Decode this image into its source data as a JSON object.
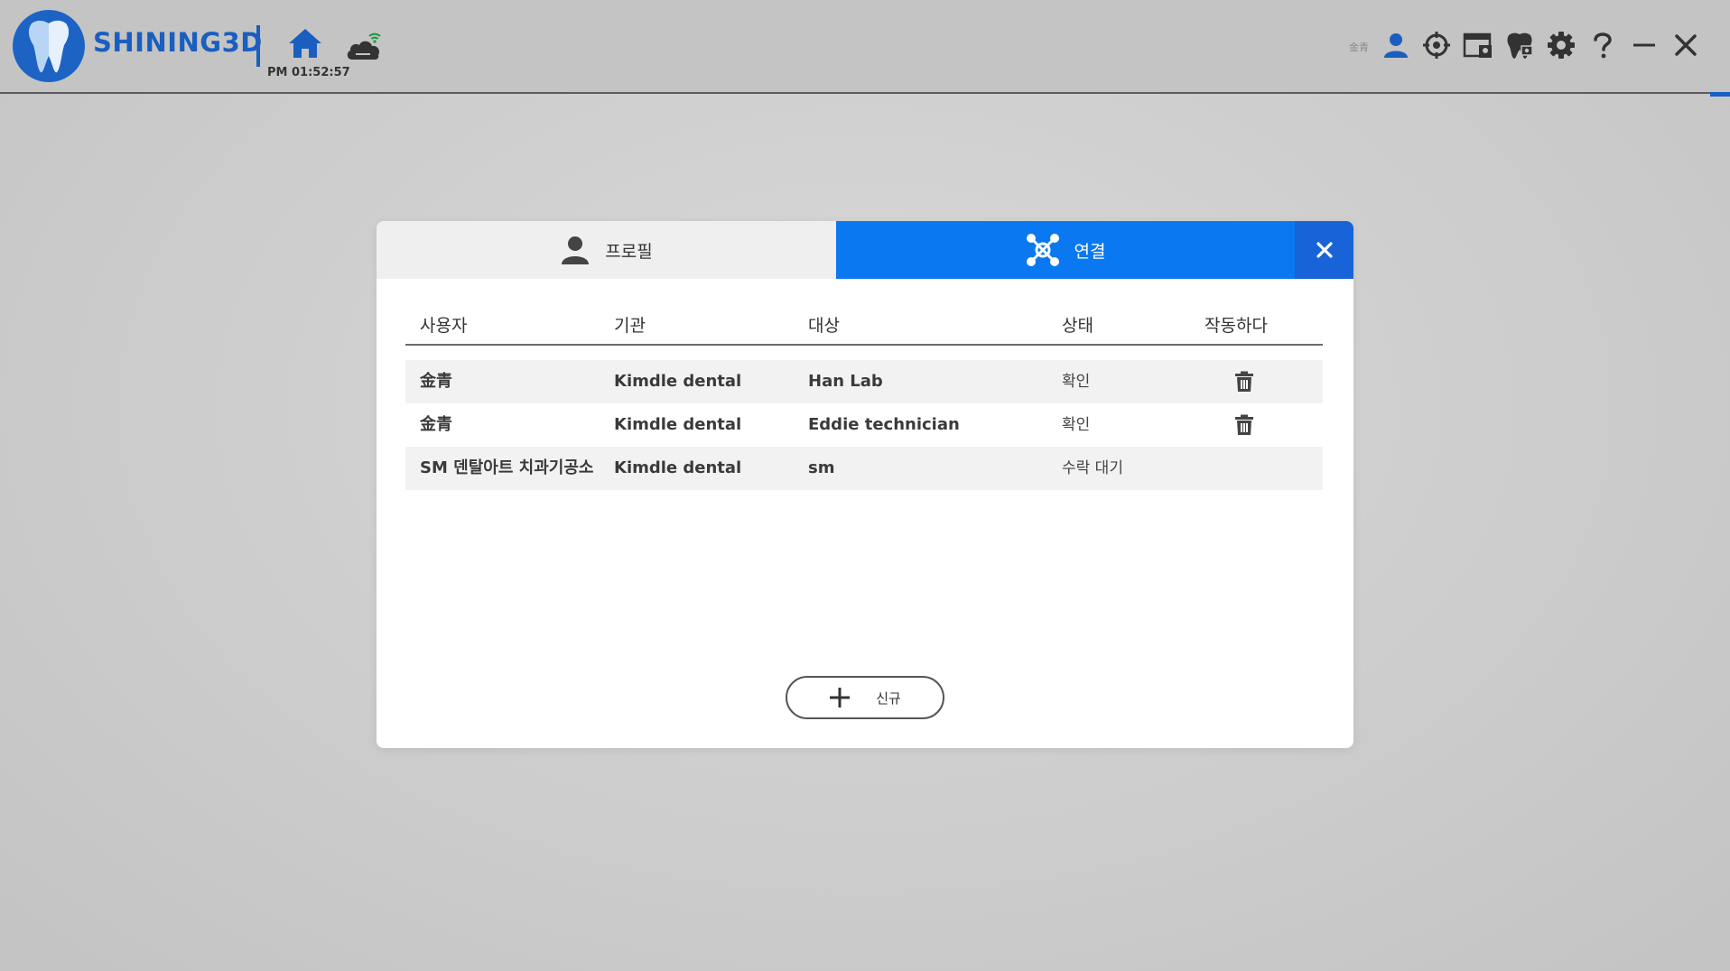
{
  "header": {
    "brand": "SHINING3D",
    "time": "PM 01:52:57",
    "user_name": "金青"
  },
  "icons": {
    "home": "home-icon",
    "cloud": "cloud-wifi-icon",
    "user": "user-icon",
    "target": "crosshair-icon",
    "browser": "browser-window-icon",
    "tooth": "tooth-icon",
    "settings": "gear-icon",
    "help": "question-icon",
    "minimize": "minimize-icon",
    "close": "close-icon"
  },
  "colors": {
    "brand_blue": "#1a5fbf",
    "tab_active": "#0a78f0",
    "tab_close": "#1863d8"
  },
  "dialog": {
    "tabs": [
      {
        "label": "프로필",
        "active": false
      },
      {
        "label": "연결",
        "active": true
      }
    ],
    "columns": [
      "사용자",
      "기관",
      "대상",
      "상태",
      "작동하다"
    ],
    "rows": [
      {
        "user": "金青",
        "org": "Kimdle dental",
        "target": "Han Lab",
        "status": "확인",
        "action": "delete"
      },
      {
        "user": "金青",
        "org": "Kimdle dental",
        "target": "Eddie technician",
        "status": "확인",
        "action": "delete"
      },
      {
        "user": "SM 덴탈아트 치과기공소",
        "org": "Kimdle dental",
        "target": "sm",
        "status": "수락 대기",
        "action": ""
      }
    ],
    "new_button_label": "신규"
  }
}
